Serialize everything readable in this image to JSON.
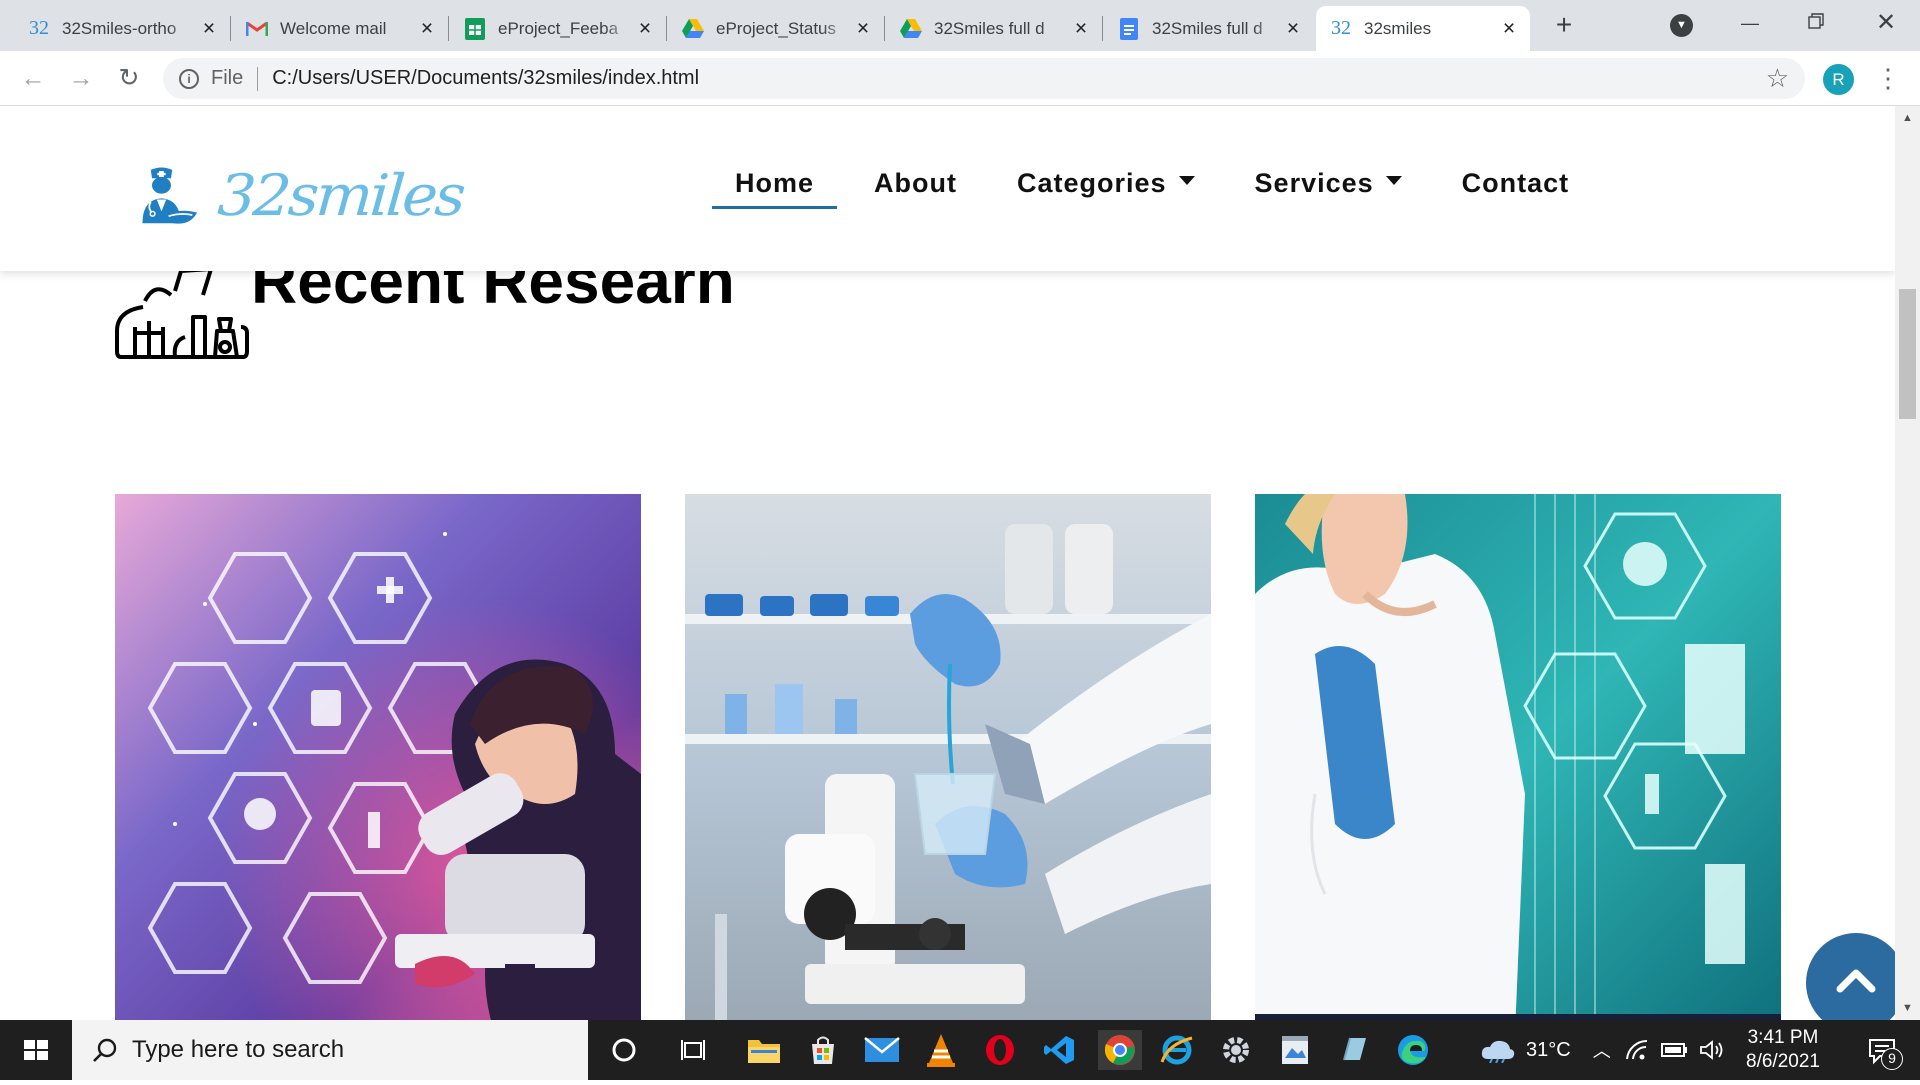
{
  "browser": {
    "tabs": [
      {
        "title": "32Smiles-ortho",
        "favicon": "32-favicon"
      },
      {
        "title": "Welcome mail",
        "favicon": "gmail-favicon"
      },
      {
        "title": "eProject_Feeba",
        "favicon": "sheets-favicon"
      },
      {
        "title": "eProject_Status",
        "favicon": "drive-favicon"
      },
      {
        "title": "32Smiles full d",
        "favicon": "drive-favicon"
      },
      {
        "title": "32Smiles full d",
        "favicon": "docs-favicon"
      },
      {
        "title": "32smiles",
        "favicon": "32-favicon",
        "active": true
      }
    ],
    "address": {
      "scheme": "File",
      "url": "C:/Users/USER/Documents/32smiles/index.html"
    },
    "profile_initial": "R"
  },
  "site": {
    "logo_text": "32smiles",
    "nav": [
      {
        "label": "Home",
        "active": true,
        "dropdown": false
      },
      {
        "label": "About",
        "active": false,
        "dropdown": false
      },
      {
        "label": "Categories",
        "active": false,
        "dropdown": true
      },
      {
        "label": "Services",
        "active": false,
        "dropdown": true
      },
      {
        "label": "Contact",
        "active": false,
        "dropdown": false
      }
    ],
    "section_title": "Recent Researh",
    "cards": [
      {
        "image": "scientist-microscope-hexagon-icons"
      },
      {
        "image": "lab-gloves-beaker-microscope"
      },
      {
        "image": "doctor-research-innovation-technology"
      }
    ]
  },
  "taskbar": {
    "search_placeholder": "Type here to search",
    "weather": "31°C",
    "time": "3:41 PM",
    "date": "8/6/2021",
    "notification_count": "9"
  },
  "colors": {
    "tabstrip": "#dee1e6",
    "logo": "#6bbde8",
    "nav_underline": "#1e6fa3",
    "back_to_top": "#2c6b9f",
    "taskbar": "#1f1f1f"
  }
}
